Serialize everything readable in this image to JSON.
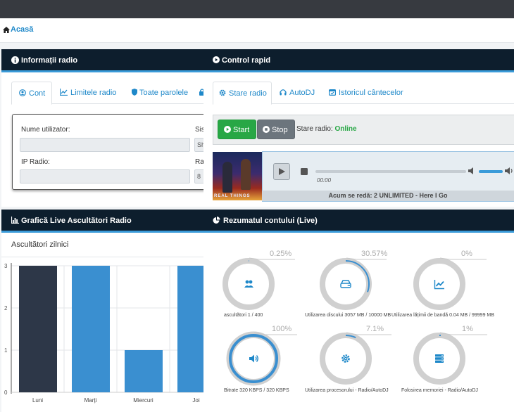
{
  "breadcrumb": {
    "home": "Acasă"
  },
  "info_panel": {
    "title": "Informații radio",
    "tabs": [
      {
        "label": "Cont",
        "icon": "user-circle-icon"
      },
      {
        "label": "Limitele radio",
        "icon": "line-chart-icon"
      },
      {
        "label": "Toate parolele",
        "icon": "shield-icon"
      }
    ],
    "fields": {
      "username_label": "Nume utilizator:",
      "ip_label": "IP Radio:",
      "right_label_1": "Sis",
      "right_label_2": "Ra",
      "right_value_1": "Sh",
      "right_value_2": "8"
    }
  },
  "control_panel": {
    "title": "Control rapid",
    "tabs": [
      {
        "label": "Stare radio",
        "icon": "gear-icon"
      },
      {
        "label": "AutoDJ",
        "icon": "headphones-icon"
      },
      {
        "label": "Istoricul cântecelor",
        "icon": "calendar-icon"
      }
    ],
    "start_label": "Start",
    "stop_label": "Stop",
    "status_label": "Stare radio:",
    "status_value": "Online",
    "player_time": "00:00",
    "now_playing": "Acum se redă: 2 UNLIMITED - Here I Go",
    "album_text": "REAL THINGS",
    "volume": 0.8,
    "progress": 0.0
  },
  "chart_panel": {
    "title": "Grafică Live Ascultători Radio",
    "subtitle": "Ascultători zilnici"
  },
  "chart_data": {
    "type": "bar",
    "categories": [
      "Luni",
      "Marți",
      "Miercuri",
      "Joi"
    ],
    "values": [
      3,
      3,
      1,
      3
    ],
    "colors": [
      "#2d3748",
      "#3a8fd0",
      "#3a8fd0",
      "#3a8fd0"
    ],
    "ylim": [
      0,
      3
    ],
    "yticks": [
      "0",
      "1",
      "2",
      "3"
    ],
    "grid": true
  },
  "summary_panel": {
    "title": "Rezumatul contului (Live)",
    "gauges": [
      {
        "pct": "0.25%",
        "value": 0.25,
        "caption": "ascultători 1 / 400",
        "icon": "users-icon"
      },
      {
        "pct": "30.57%",
        "value": 30.57,
        "caption": "Utilizarea discului 3057 MB / 10000 MB",
        "icon": "hard-drive-icon"
      },
      {
        "pct": "0%",
        "value": 0,
        "caption": "Utilizarea lățimii de bandă 0.04 MB / 99999 MB",
        "icon": "line-chart-icon"
      },
      {
        "pct": "100%",
        "value": 100,
        "caption": "Bitrate 320 KBPS / 320 KBPS",
        "icon": "volume-icon"
      },
      {
        "pct": "7.1%",
        "value": 7.1,
        "caption": "Utilizarea procesorului - Radio/AutoDJ",
        "icon": "gear-icon"
      },
      {
        "pct": "1%",
        "value": 1,
        "caption": "Folosirea memoriei - Radio/AutoDJ",
        "icon": "server-icon"
      }
    ]
  },
  "colors": {
    "accent": "#3a9bd9",
    "header": "#0d1e2d",
    "start": "#28a745",
    "stop": "#6c757d",
    "online": "#28a745"
  }
}
